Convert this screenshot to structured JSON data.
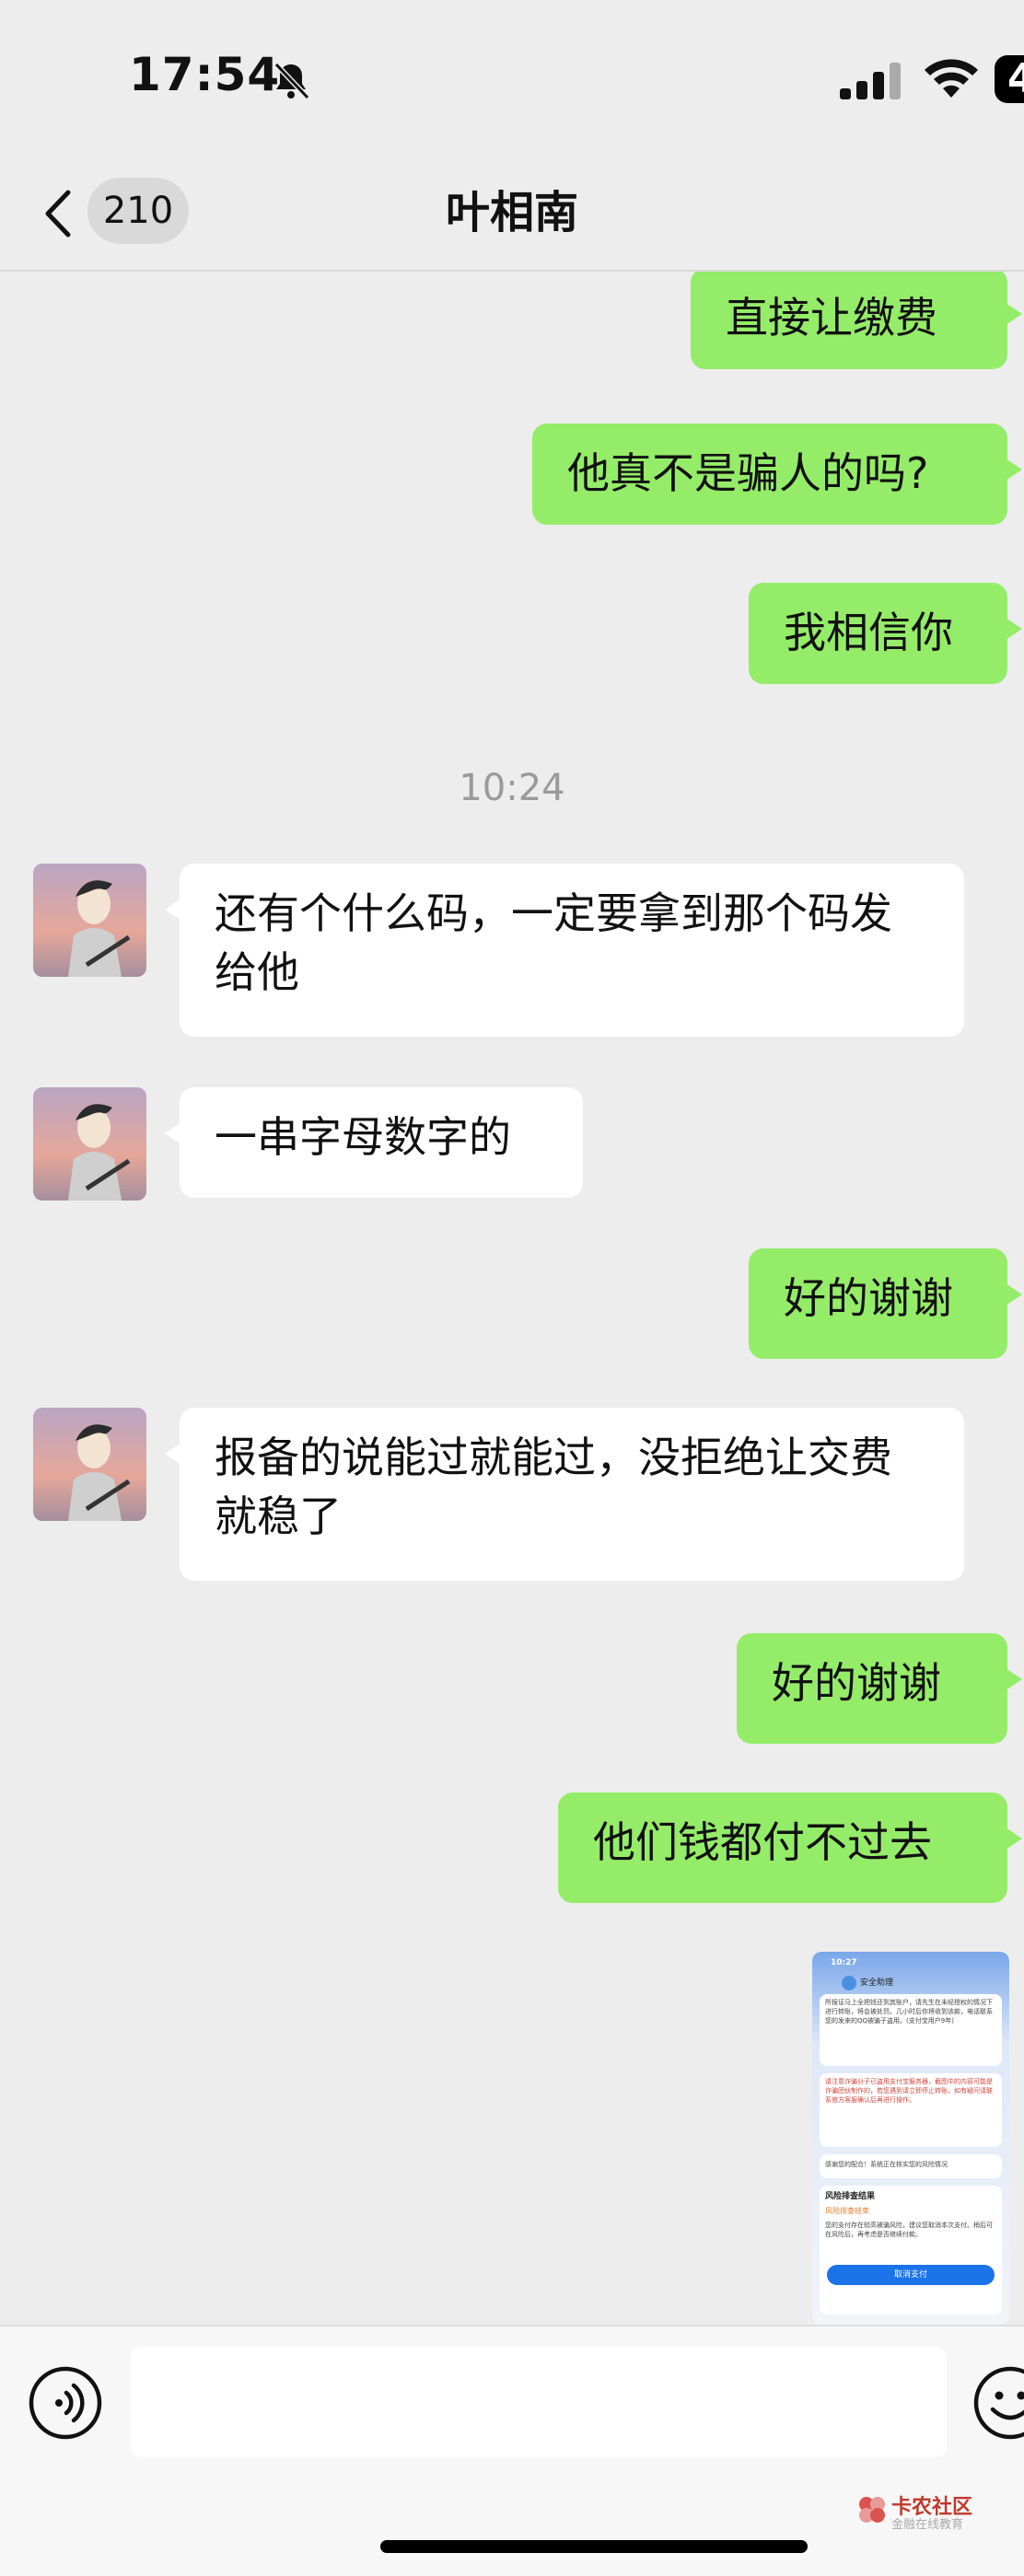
{
  "status_bar": {
    "time": "17:54",
    "battery": "4"
  },
  "header": {
    "unread_count": "210",
    "title": "叶相南"
  },
  "messages": [
    {
      "side": "right",
      "text": "直接让缴费"
    },
    {
      "side": "right",
      "text": "他真不是骗人的吗?"
    },
    {
      "side": "right",
      "text": "我相信你"
    },
    {
      "timestamp": "10:24"
    },
    {
      "side": "left",
      "text": "还有个什么码，一定要拿到那个码发给他"
    },
    {
      "side": "left",
      "text": "一串字母数字的"
    },
    {
      "side": "right",
      "text": "好的谢谢"
    },
    {
      "side": "left",
      "text": "报备的说能过就能过，没拒绝让交费就稳了"
    },
    {
      "side": "right",
      "text": "好的谢谢"
    },
    {
      "side": "right",
      "text": "他们钱都付不过去"
    }
  ],
  "image_message": {
    "time": "10:27",
    "title": "安全助理",
    "paragraph1": "所报证马上全把钱还到其账户，请先生在未经授权的情况下进行转账，将会被处罚。几小时后你将收到该款，电话联系您的发来的QQ被骗子盗用。(支付宝用户9年)",
    "paragraph2": "请注意诈骗分子已盗用支付宝服务器，截图中的内容可能是诈骗团伙制作的，若您遇到请立即停止转账，如有疑问请联系官方客服确认后再进行操作。",
    "paragraph3": "感谢您的配合！系统正在核实您的风险情况",
    "result_title": "风险排查结果",
    "result_tag": "风险排查结束",
    "result_body": "您的支付存在较高被骗风险，建议您取消本次支付。稍后可在风险后，再考虑是否继续付款。",
    "cancel_button": "取消支付"
  },
  "input_bar": {
    "placeholder": ""
  },
  "watermark": {
    "title": "卡农社区",
    "subtitle": "金融在线教育"
  },
  "colors": {
    "my_bubble": "#95ec69",
    "their_bubble": "#ffffff",
    "background": "#ededed"
  }
}
